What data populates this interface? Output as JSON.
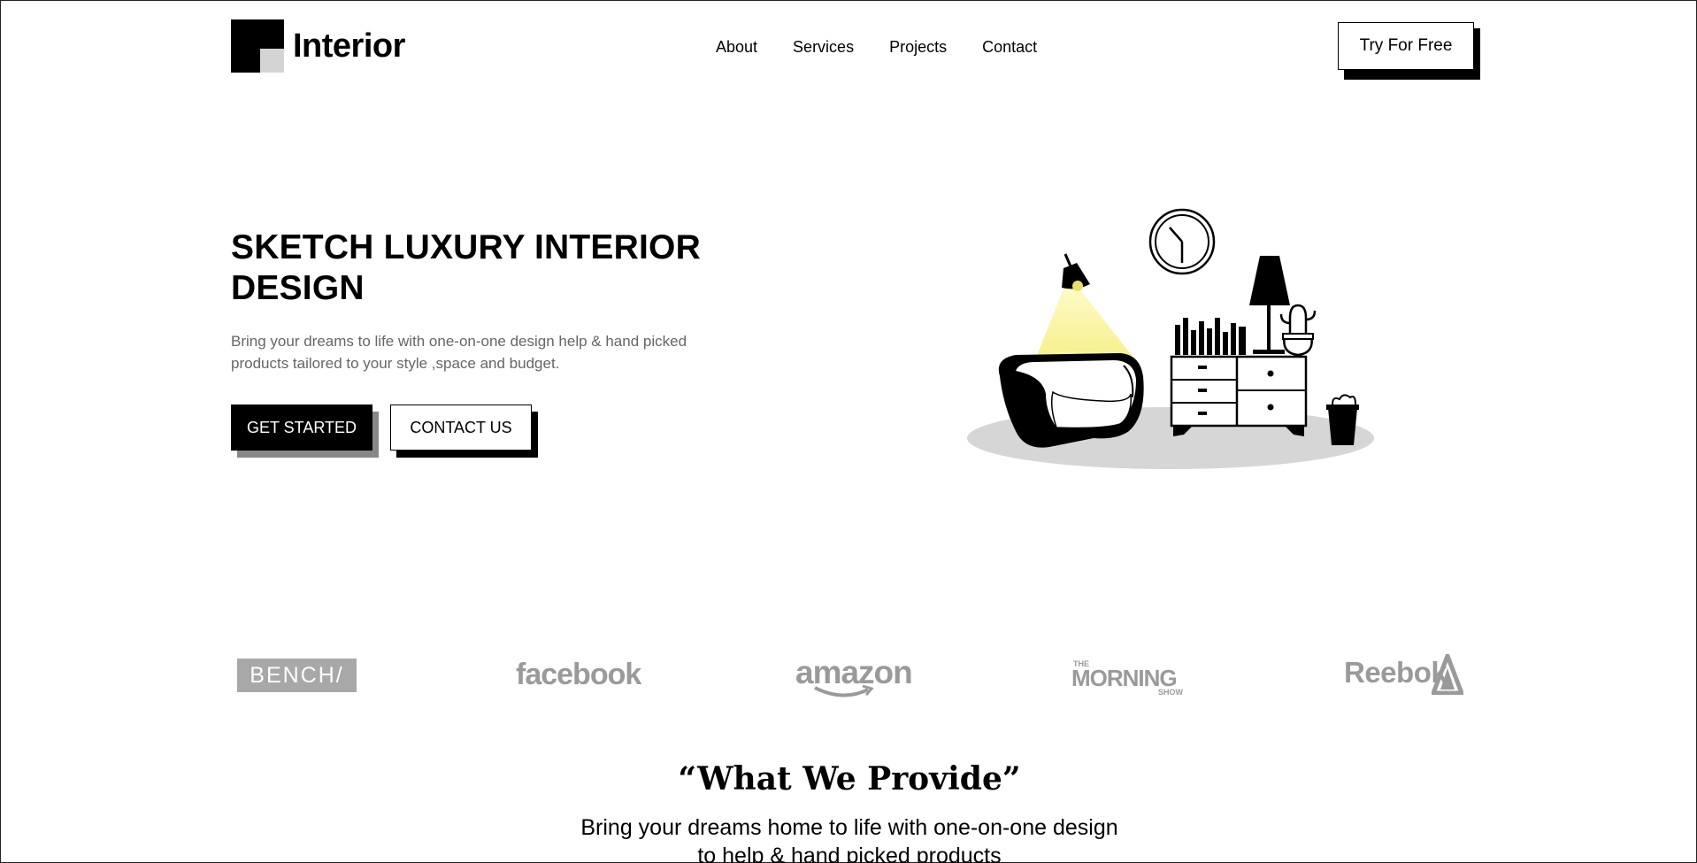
{
  "header": {
    "brand": "Interior",
    "nav": [
      "About",
      "Services",
      "Projects",
      "Contact"
    ],
    "cta_label": "Try For Free"
  },
  "hero": {
    "title": "SKETCH LUXURY INTERIOR DESIGN",
    "subtitle": "Bring your dreams to life with one-on-one design help & hand picked products tailored to your style ,space and budget.",
    "primary_button": "GET STARTED",
    "secondary_button": "CONTACT US"
  },
  "brands": {
    "bench": "BENCH/",
    "facebook": "facebook",
    "amazon": "amazon",
    "morning_small": "THE",
    "morning_big": "MORNING",
    "morning_show": "SHOW",
    "reebok": "Reebok"
  },
  "provide": {
    "title": "“What We Provide”",
    "subtitle_line1": "Bring your dreams home to life with one-on-one design",
    "subtitle_line2": "to help & hand picked products"
  },
  "colors": {
    "accent": "#000000",
    "logo_gray": "#d4d4d4",
    "brand_gray": "#9a9a9a",
    "lamp_glow": "#f5f08a"
  }
}
